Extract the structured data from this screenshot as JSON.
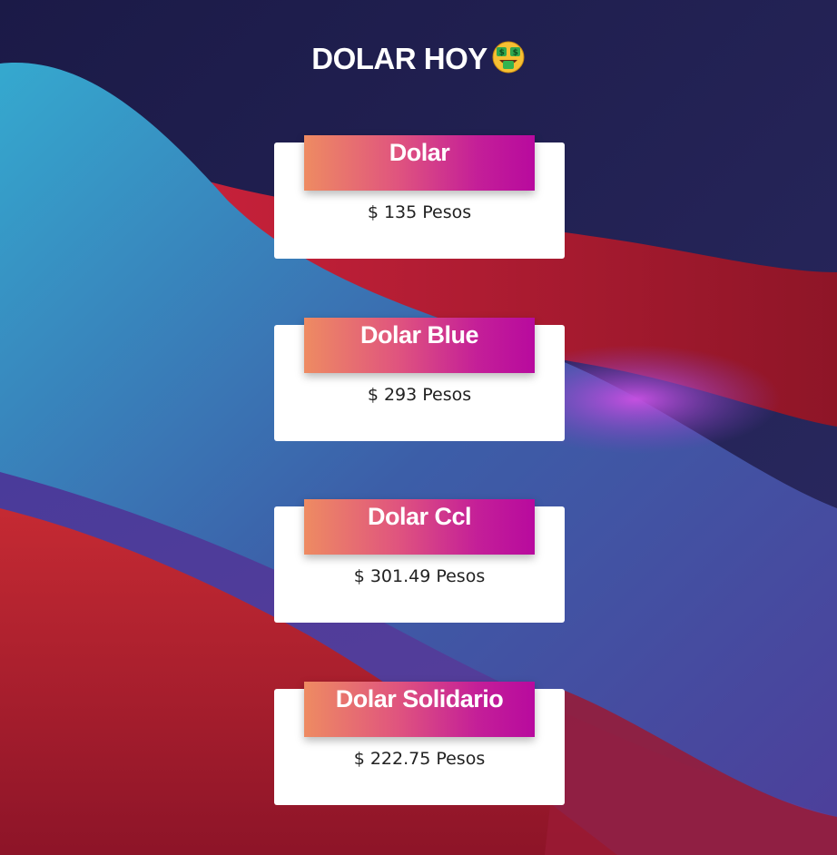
{
  "page": {
    "title": "DOLAR HOY",
    "title_emoji": "money-mouth-face-icon"
  },
  "cards": [
    {
      "name": "Dolar",
      "currency_symbol": "$",
      "value": "135",
      "unit": "Pesos"
    },
    {
      "name": "Dolar Blue",
      "currency_symbol": "$",
      "value": "293",
      "unit": "Pesos"
    },
    {
      "name": "Dolar Ccl",
      "currency_symbol": "$",
      "value": "301.49",
      "unit": "Pesos"
    },
    {
      "name": "Dolar Solidario",
      "currency_symbol": "$",
      "value": "222.75",
      "unit": "Pesos"
    }
  ],
  "colors": {
    "gradient_start": "#ee8b62",
    "gradient_end": "#b80a9e",
    "background_dark": "#1c1c4a",
    "card_background": "#ffffff"
  }
}
